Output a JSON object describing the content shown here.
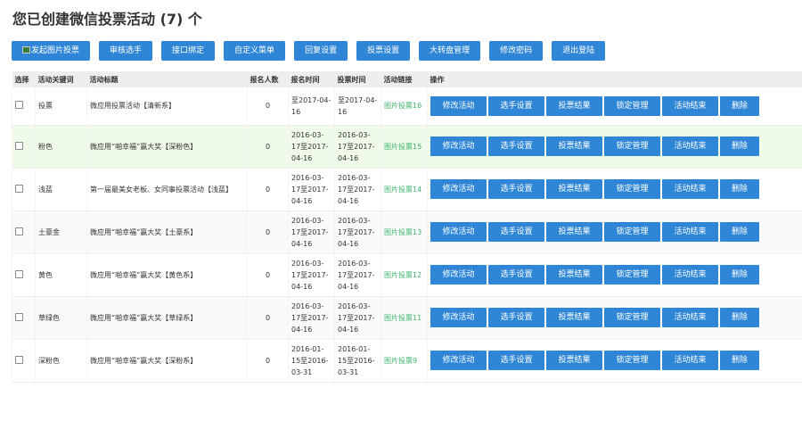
{
  "title": "您已创建微信投票活动 (7) 个",
  "toolbar": [
    "发起图片投票",
    "审核选手",
    "接口绑定",
    "自定义菜单",
    "回复设置",
    "投票设置",
    "大转盘管理",
    "修改密码",
    "退出登陆"
  ],
  "headers": [
    "选择",
    "活动关键词",
    "活动标题",
    "报名人数",
    "报名时间",
    "投票时间",
    "活动链接",
    "操作"
  ],
  "actions": [
    "修改活动",
    "选手设置",
    "投票结果",
    "锁定管理",
    "活动结束",
    "删除"
  ],
  "rows": [
    {
      "keyword": "投票",
      "title": "微应用投票活动【清新系】",
      "count": "0",
      "reg_time": "至2017-04-16",
      "vote_time": "至2017-04-16",
      "link": "图片投票16"
    },
    {
      "keyword": "粉色",
      "title": "微应用“啪幸福”赢大奖【深粉色】",
      "count": "0",
      "reg_time": "2016-03-17至2017-04-16",
      "vote_time": "2016-03-17至2017-04-16",
      "link": "图片投票15"
    },
    {
      "keyword": "浅蓝",
      "title": "第一届最美女老板、女同事投票活动【浅蓝】",
      "count": "0",
      "reg_time": "2016-03-17至2017-04-16",
      "vote_time": "2016-03-17至2017-04-16",
      "link": "图片投票14"
    },
    {
      "keyword": "土豪金",
      "title": "微应用“啪幸福”赢大奖【土豪系】",
      "count": "0",
      "reg_time": "2016-03-17至2017-04-16",
      "vote_time": "2016-03-17至2017-04-16",
      "link": "图片投票13"
    },
    {
      "keyword": "黄色",
      "title": "微应用“啪幸福”赢大奖【黄色系】",
      "count": "0",
      "reg_time": "2016-03-17至2017-04-16",
      "vote_time": "2016-03-17至2017-04-16",
      "link": "图片投票12"
    },
    {
      "keyword": "草绿色",
      "title": "微应用“啪幸福”赢大奖【草绿系】",
      "count": "0",
      "reg_time": "2016-03-17至2017-04-16",
      "vote_time": "2016-03-17至2017-04-16",
      "link": "图片投票11"
    },
    {
      "keyword": "深粉色",
      "title": "微应用“啪幸福”赢大奖【深粉系】",
      "count": "0",
      "reg_time": "2016-01-15至2016-03-31",
      "vote_time": "2016-01-15至2016-03-31",
      "link": "图片投票9"
    }
  ]
}
